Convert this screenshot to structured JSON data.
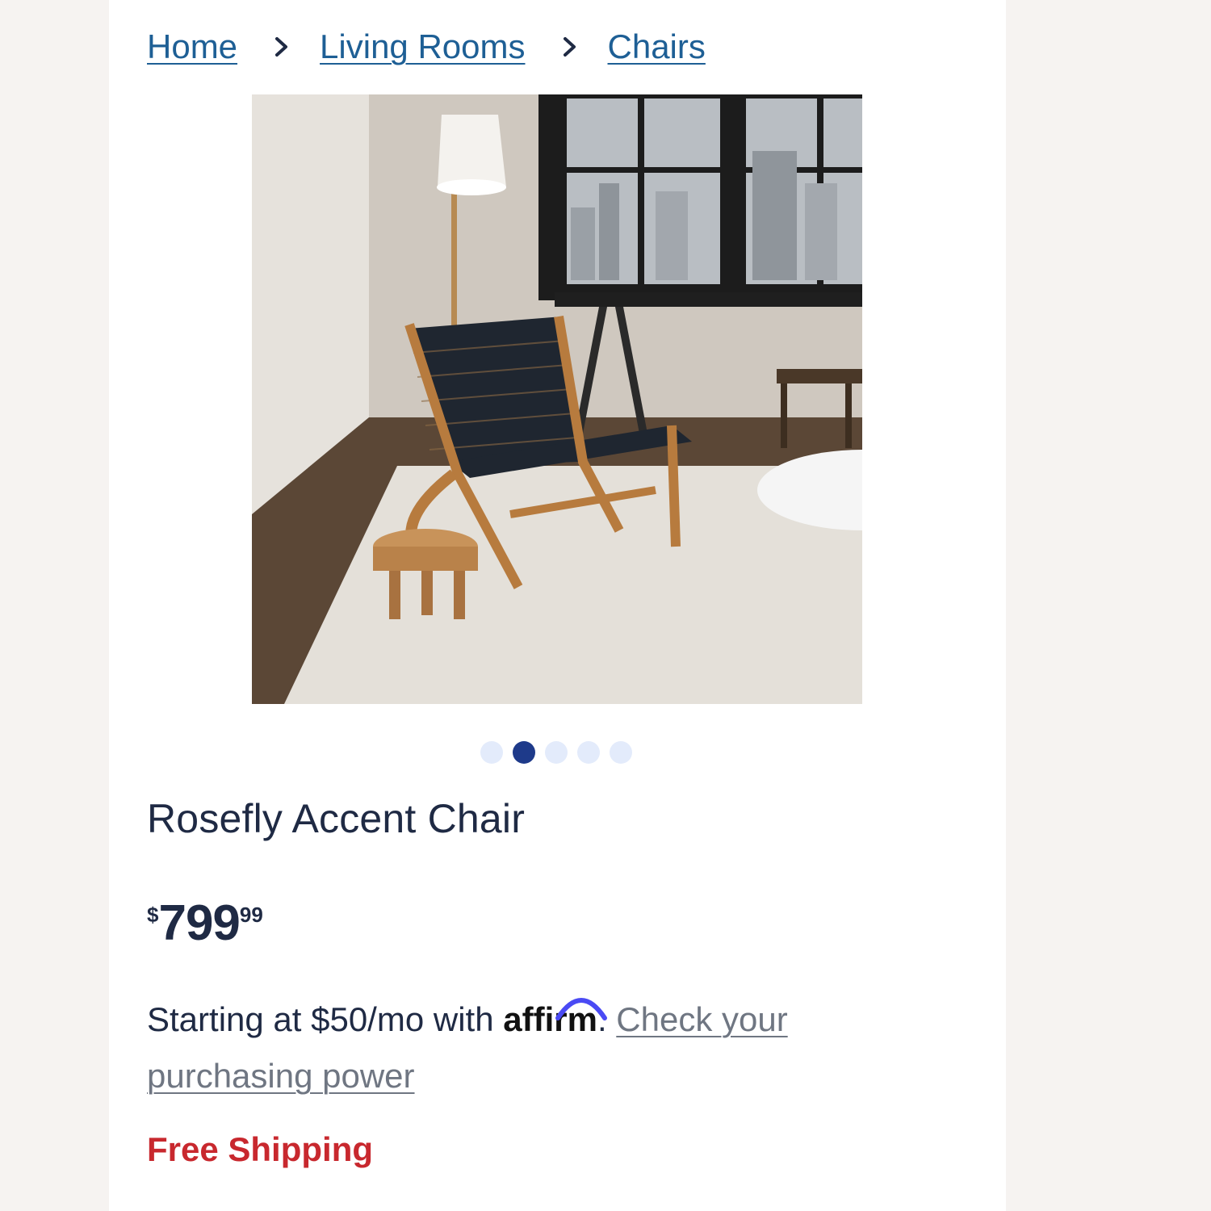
{
  "breadcrumb": {
    "items": [
      {
        "label": "Home"
      },
      {
        "label": "Living Rooms"
      },
      {
        "label": "Chairs"
      }
    ]
  },
  "gallery": {
    "dot_count": 5,
    "active_index": 1,
    "image_description_icon": "product-photo"
  },
  "product": {
    "title": "Rosefly Accent Chair",
    "price": {
      "currency_symbol": "$",
      "dollars": "799",
      "cents": "99"
    },
    "financing": {
      "prefix": "Starting at $50/mo with",
      "brand": "affirm",
      "period": ".",
      "link_text": "Check your purchasing power"
    },
    "shipping": "Free Shipping"
  },
  "colors": {
    "link": "#1e5f95",
    "price_text": "#1f2a44",
    "shipping": "#c8282e",
    "active_dot": "#1e3a8a",
    "inactive_dot": "#e3ebfb",
    "affirm_arc": "#4a4af4"
  }
}
